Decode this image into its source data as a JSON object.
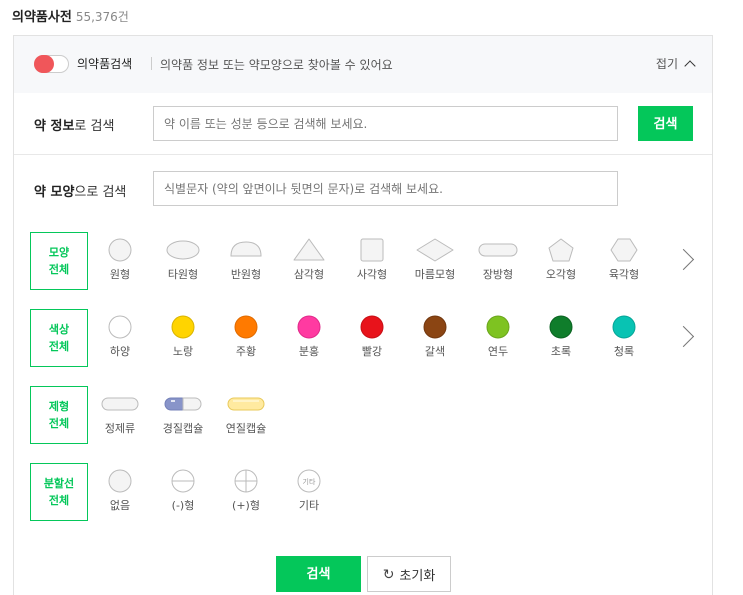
{
  "header": {
    "title": "의약품사전",
    "count": "55,376건"
  },
  "topbar": {
    "toggle_label": "의약품검색",
    "description": "의약품 정보 또는 약모양으로 찾아볼 수 있어요",
    "fold_label": "접기"
  },
  "info_search": {
    "label_bold": "약 정보",
    "label_rest": "로 검색",
    "placeholder": "약 이름 또는 성분 등으로 검색해 보세요.",
    "button": "검색"
  },
  "shape_search": {
    "label_bold": "약 모양",
    "label_rest": "으로 검색",
    "placeholder": "식별문자 (약의 앞면이나 뒷면의 문자)로 검색해 보세요."
  },
  "filters": {
    "shape": {
      "category_line1": "모양",
      "category_line2": "전체",
      "options": [
        "원형",
        "타원형",
        "반원형",
        "삼각형",
        "사각형",
        "마름모형",
        "장방형",
        "오각형",
        "육각형"
      ]
    },
    "color": {
      "category_line1": "색상",
      "category_line2": "전체",
      "options": [
        {
          "label": "하양",
          "color": "#ffffff"
        },
        {
          "label": "노랑",
          "color": "#ffd400"
        },
        {
          "label": "주황",
          "color": "#ff7a00"
        },
        {
          "label": "분홍",
          "color": "#ff3aa1"
        },
        {
          "label": "빨강",
          "color": "#e8131b"
        },
        {
          "label": "갈색",
          "color": "#8b4513"
        },
        {
          "label": "연두",
          "color": "#7ec321"
        },
        {
          "label": "초록",
          "color": "#0f7d2b"
        },
        {
          "label": "청록",
          "color": "#08c3b3"
        }
      ]
    },
    "form": {
      "category_line1": "제형",
      "category_line2": "전체",
      "options": [
        "정제류",
        "경질캡슐",
        "연질캡슐"
      ]
    },
    "split": {
      "category_line1": "분할선",
      "category_line2": "전체",
      "options": [
        "없음",
        "(-)형",
        "(+)형",
        "기타"
      ],
      "etc_icon_text": "기타"
    }
  },
  "actions": {
    "search": "검색",
    "reset": "초기화"
  },
  "colors": {
    "accent": "#04c75a",
    "toggle": "#f0565a"
  }
}
